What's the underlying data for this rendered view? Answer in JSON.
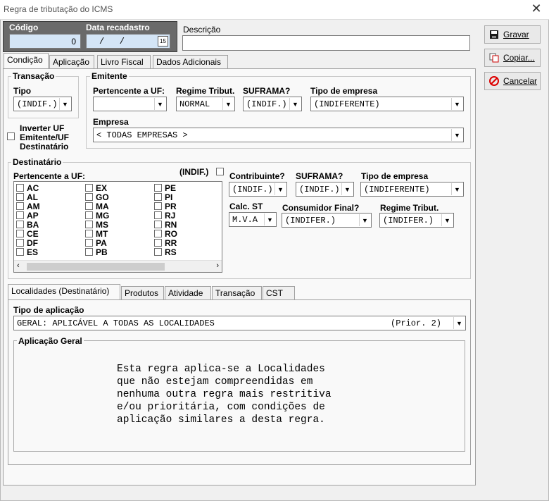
{
  "window": {
    "title": "Regra de tributação do ICMS",
    "close_glyph": "✕"
  },
  "header": {
    "codigo_label": "Código",
    "codigo_value": "0",
    "data_label": "Data recadastro",
    "data_value": "/   /",
    "calendar_glyph": "15",
    "descricao_label": "Descrição",
    "descricao_value": ""
  },
  "buttons": {
    "gravar": "Gravar",
    "copiar": "Copiar...",
    "cancelar": "Cancelar"
  },
  "main_tabs": [
    "Condição",
    "Aplicação",
    "Livro Fiscal",
    "Dados Adicionais"
  ],
  "transacao": {
    "title": "Transação",
    "tipo_label": "Tipo",
    "tipo_value": "(INDIF.)"
  },
  "emitente": {
    "title": "Emitente",
    "uf_label": "Pertencente a UF:",
    "uf_value": "",
    "regime_label": "Regime Tribut.",
    "regime_value": "NORMAL",
    "suframa_label": "SUFRAMA?",
    "suframa_value": "(INDIF.)",
    "tipo_empresa_label": "Tipo de empresa",
    "tipo_empresa_value": "(INDIFERENTE)",
    "empresa_label": "Empresa",
    "empresa_value": "< TODAS EMPRESAS >"
  },
  "inverter": {
    "line1": "Inverter UF",
    "line2": "Emitente/UF",
    "line3": "Destinatário"
  },
  "destinatario": {
    "title": "Destinatário",
    "uf_label": "Pertencente a UF:",
    "indif_label": "(INDIF.)",
    "ufs_col1": [
      "AC",
      "AL",
      "AM",
      "AP",
      "BA",
      "CE",
      "DF",
      "ES"
    ],
    "ufs_col2": [
      "EX",
      "GO",
      "MA",
      "MG",
      "MS",
      "MT",
      "PA",
      "PB"
    ],
    "ufs_col3": [
      "PE",
      "PI",
      "PR",
      "RJ",
      "RN",
      "RO",
      "RR",
      "RS"
    ],
    "contribuinte_label": "Contribuinte?",
    "contribuinte_value": "(INDIF.)",
    "suframa_label": "SUFRAMA?",
    "suframa_value": "(INDIF.)",
    "tipo_empresa_label": "Tipo de empresa",
    "tipo_empresa_value": "(INDIFERENTE)",
    "calc_st_label": "Calc. ST",
    "calc_st_value": "M.V.A",
    "consumidor_label": "Consumidor Final?",
    "consumidor_value": "(INDIFER.)",
    "regime_label": "Regime Tribut.",
    "regime_value": "(INDIFER.)"
  },
  "sub_tabs": [
    "Localidades (Destinatário)",
    "Produtos",
    "Atividade",
    "Transação",
    "CST"
  ],
  "localidades": {
    "tipo_label": "Tipo de aplicação",
    "tipo_value": "GERAL: APLICÁVEL A TODAS AS LOCALIDADES",
    "tipo_priority": "(Prior. 2)",
    "aplicacao_title": "Aplicação Geral",
    "aplicacao_text": "Esta regra aplica-se a Localidades\nque não estejam compreendidas em\nnenhuma outra regra mais restritiva\ne/ou prioritária, com condições de\naplicação similares a desta regra."
  }
}
